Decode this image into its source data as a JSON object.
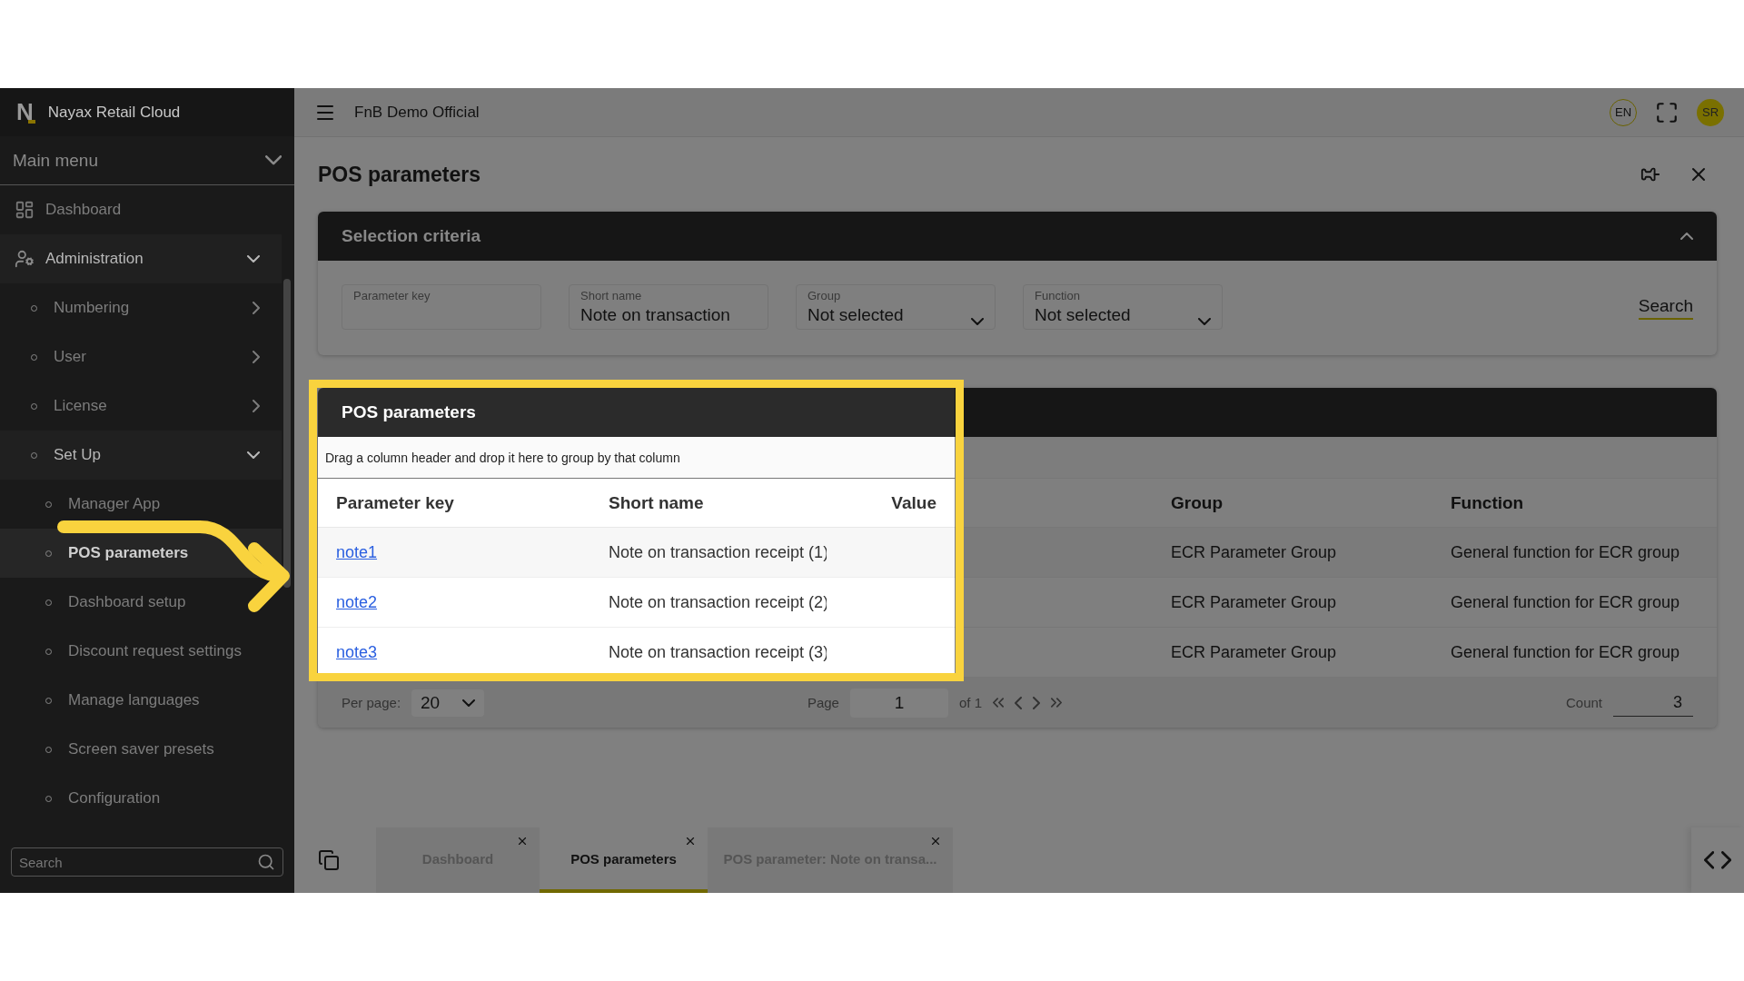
{
  "sidebar": {
    "logo_mark": "N",
    "brand": "Nayax Retail Cloud",
    "main_menu": "Main menu",
    "items": [
      {
        "label": "Dashboard",
        "selected": false
      },
      {
        "label": "Administration",
        "selected": false,
        "expanded": true,
        "children": [
          {
            "label": "Numbering",
            "selected": false,
            "expanded": false
          },
          {
            "label": "User",
            "selected": false,
            "expanded": false
          },
          {
            "label": "License",
            "selected": false,
            "expanded": false
          },
          {
            "label": "Set Up",
            "selected": false,
            "expanded": true,
            "children": [
              {
                "label": "Manager App",
                "selected": false
              },
              {
                "label": "POS parameters",
                "selected": true
              },
              {
                "label": "Dashboard setup",
                "selected": false
              },
              {
                "label": "Discount request settings",
                "selected": false
              },
              {
                "label": "Manage languages",
                "selected": false
              },
              {
                "label": "Screen saver presets",
                "selected": false
              },
              {
                "label": "Configuration",
                "selected": false
              }
            ]
          }
        ]
      }
    ],
    "search": {
      "placeholder": "Search"
    }
  },
  "topbar": {
    "company": "FnB Demo Official",
    "language": "EN",
    "user_initials": "SR"
  },
  "page": {
    "title": "POS parameters"
  },
  "selection_criteria": {
    "title": "Selection criteria",
    "expanded": true,
    "fields": [
      {
        "kind": "text",
        "label": "Parameter key"
      },
      {
        "kind": "text",
        "label": "Short name",
        "value": "Note on transaction"
      },
      {
        "kind": "select",
        "label": "Group",
        "value": "Not selected"
      },
      {
        "kind": "select",
        "label": "Function",
        "value": "Not selected"
      }
    ],
    "search_button": "Search"
  },
  "table": {
    "title": "POS parameters",
    "group_hint": "Drag a column header and drop it here to group by that column",
    "columns": [
      "Parameter key",
      "Short name",
      "Value",
      "Group",
      "Function"
    ],
    "rows": [
      {
        "parameter_key": "note1",
        "short_name": "Note on transaction receipt (1)",
        "group": "ECR Parameter Group",
        "function": "General function for ECR group"
      },
      {
        "parameter_key": "note2",
        "short_name": "Note on transaction receipt (2)",
        "group": "ECR Parameter Group",
        "function": "General function for ECR group"
      },
      {
        "parameter_key": "note3",
        "short_name": "Note on transaction receipt (3)",
        "group": "ECR Parameter Group",
        "function": "General function for ECR group"
      }
    ],
    "pager": {
      "per_page_label": "Per page:",
      "per_page": "20",
      "page_label": "Page",
      "page": "1",
      "of_pages": "of 1",
      "count_label": "Count",
      "count": "3"
    }
  },
  "bottom_tabs": [
    {
      "label": "Dashboard",
      "selected": false
    },
    {
      "label": "POS parameters",
      "selected": true
    },
    {
      "label": "POS parameter: Note on transa...",
      "selected": false
    }
  ]
}
